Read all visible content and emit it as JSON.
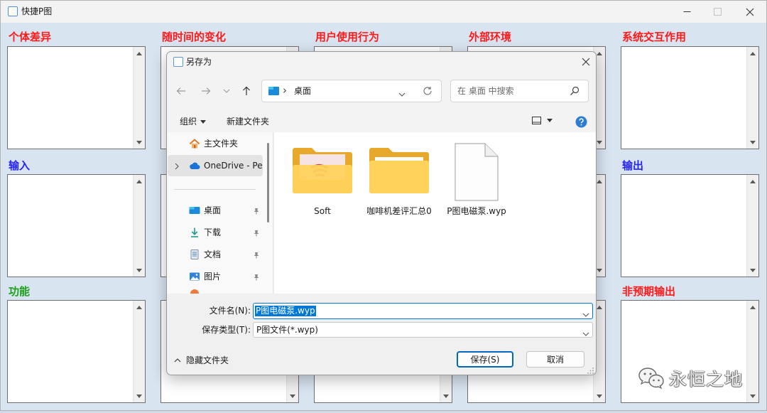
{
  "app": {
    "title": "快捷P图",
    "icon": "app-icon",
    "window_controls": [
      "minimize-icon",
      "maximize-icon",
      "close-icon"
    ]
  },
  "panels": [
    {
      "label": "个体差异",
      "color": "#ff1a1a"
    },
    {
      "label": "随时间的变化",
      "color": "#ff1a1a"
    },
    {
      "label": "用户使用行为",
      "color": "#ff1a1a"
    },
    {
      "label": "外部环境",
      "color": "#ff1a1a"
    },
    {
      "label": "系统交互作用",
      "color": "#ff1a1a"
    },
    {
      "label": "输入",
      "color": "#2424ff"
    },
    {},
    {},
    {},
    {
      "label": "输出",
      "color": "#2424ff"
    },
    {
      "label": "功能",
      "color": "#1c9f1c"
    },
    {},
    {},
    {},
    {
      "label": "非预期输出",
      "color": "#ff1a1a"
    }
  ],
  "dialog": {
    "title": "另存为",
    "nav_icons": [
      "arrow-left-icon",
      "arrow-right-icon",
      "chevron-down-icon",
      "arrow-up-icon"
    ],
    "address": {
      "icon": "desktop-icon",
      "separator": "›",
      "location": "桌面"
    },
    "search": {
      "placeholder": "在 桌面 中搜索"
    },
    "toolbar": {
      "organize": "组织",
      "new_folder": "新建文件夹",
      "view_icon": "view-icon",
      "help_icon": "help-icon"
    },
    "sidebar": [
      {
        "label": "主文件夹",
        "icon": "home-icon",
        "pinned": false
      },
      {
        "label": "OneDrive - Per",
        "icon": "cloud-icon",
        "expandable": true,
        "selected": true
      },
      {
        "label": "桌面",
        "icon": "desktop-icon",
        "pinned": true
      },
      {
        "label": "下载",
        "icon": "download-icon",
        "pinned": true
      },
      {
        "label": "文档",
        "icon": "document-icon",
        "pinned": true
      },
      {
        "label": "图片",
        "icon": "pictures-icon",
        "pinned": true
      }
    ],
    "files": [
      {
        "name": "Soft",
        "type": "folder"
      },
      {
        "name": "咖啡机差评汇总0",
        "type": "folder"
      },
      {
        "name": "P图电磁泵.wyp",
        "type": "file"
      }
    ],
    "filename": {
      "label": "文件名(N):",
      "value": "P图电磁泵.wyp",
      "selected": true
    },
    "filetype": {
      "label": "保存类型(T):",
      "value": "P图文件(*.wyp)"
    },
    "hide_folders": "隐藏文件夹",
    "buttons": {
      "save": "保存(S)",
      "cancel": "取消"
    }
  },
  "watermark": {
    "text": "永恒之地",
    "icon": "wechat-icon"
  },
  "colors": {
    "accent": "#0078d7",
    "window_background": "#d9e4f1",
    "help_blue": "#2b7cd3",
    "folder_yellow": "#ffd35a"
  }
}
